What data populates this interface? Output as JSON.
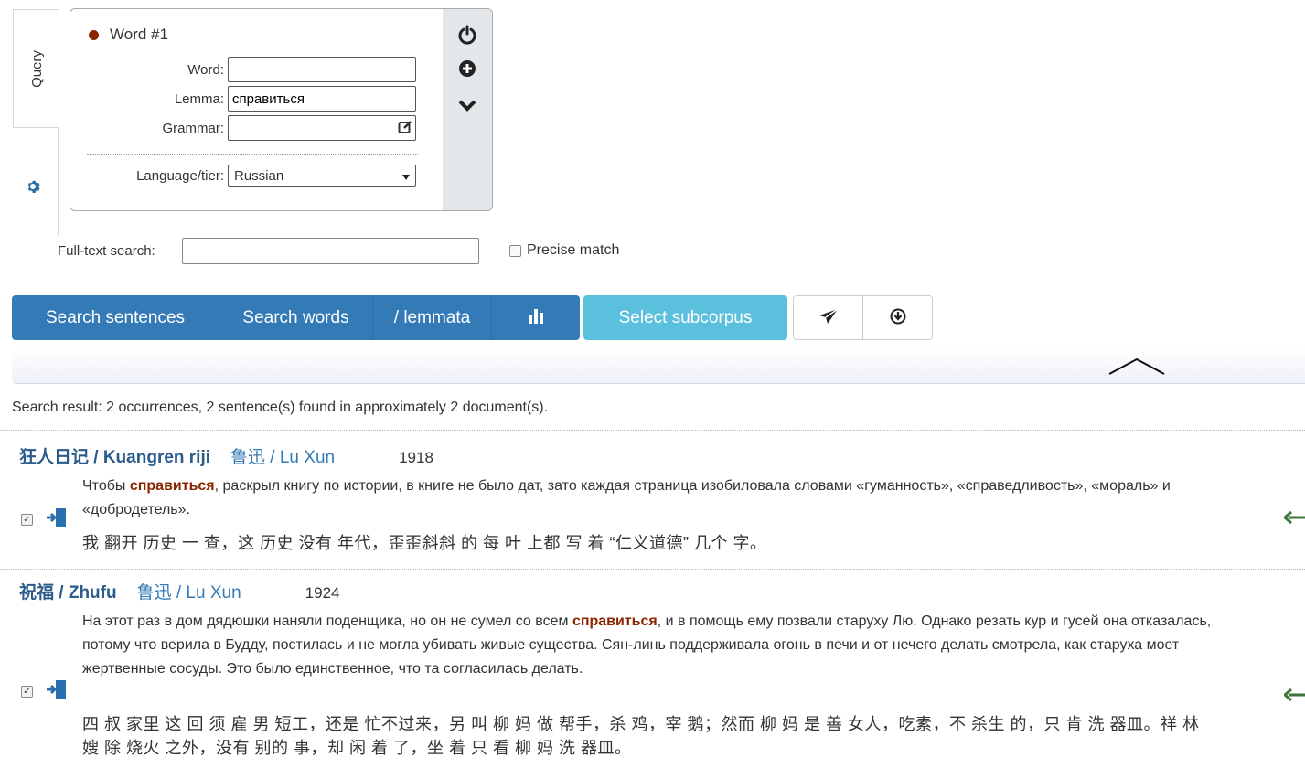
{
  "tabs": {
    "query": "Query"
  },
  "word": {
    "title": "Word #1",
    "word_label": "Word:",
    "word_value": "",
    "lemma_label": "Lemma:",
    "lemma_value": "справиться",
    "grammar_label": "Grammar:",
    "grammar_value": "",
    "language_label": "Language/tier:",
    "language_value": "Russian"
  },
  "fulltext": {
    "label": "Full-text search:",
    "value": "",
    "precise": "Precise match"
  },
  "buttons": {
    "search_sentences": "Search sentences",
    "search_words": "Search words",
    "lemmata": "/ lemmata",
    "select_subcorpus": "Select subcorpus"
  },
  "summary": "Search result: 2 occurrences, 2 sentence(s) found in approximately 2 document(s).",
  "results": [
    {
      "title": "狂人日记 / Kuangren riji",
      "author": "鲁迅 / Lu Xun",
      "year": "1918",
      "ru_before": "Чтобы ",
      "ru_hit": "справиться",
      "ru_after": ", раскрыл книгу по истории, в книге не было дат, зато каждая страница изобиловала словами «гуманность», «справедливость», «мораль» и «добродетель».",
      "zh": "我 翻开 历史 一 查，这 历史 没有 年代，歪歪斜斜 的 每 叶 上都 写 着 “仁义道德” 几个 字。"
    },
    {
      "title": "祝福 / Zhufu",
      "author": "鲁迅 / Lu Xun",
      "year": "1924",
      "ru_before": "На этот раз в дом дядюшки наняли поденщика, но он не сумел со всем ",
      "ru_hit": "справиться",
      "ru_after": ", и в помощь ему позвали старуху Лю. Однако резать кур и гусей она отказалась, потому что верила в Будду, постилась и не могла убивать живые существа. Сян-линь поддерживала огонь в печи и от нечего делать смотрела, как старуха моет жертвенные сосуды. Это было единственное, что та согласилась делать.",
      "zh": "四 叔 家里 这 回 须 雇 男 短工，还是 忙不过来，另 叫 柳 妈 做 帮手，杀 鸡，宰 鹅；然而 柳 妈 是 善 女人，吃素，不 杀生 的，只 肯 洗 器皿。祥 林 嫂 除 烧火 之外，没有 别的 事，却 闲 着 了，坐 着 只 看 柳 妈 洗 器皿。"
    }
  ],
  "colors": {
    "primary": "#337ab7",
    "info": "#5bc0de",
    "hit": "#8b2500",
    "arrow": "#3c763d"
  }
}
